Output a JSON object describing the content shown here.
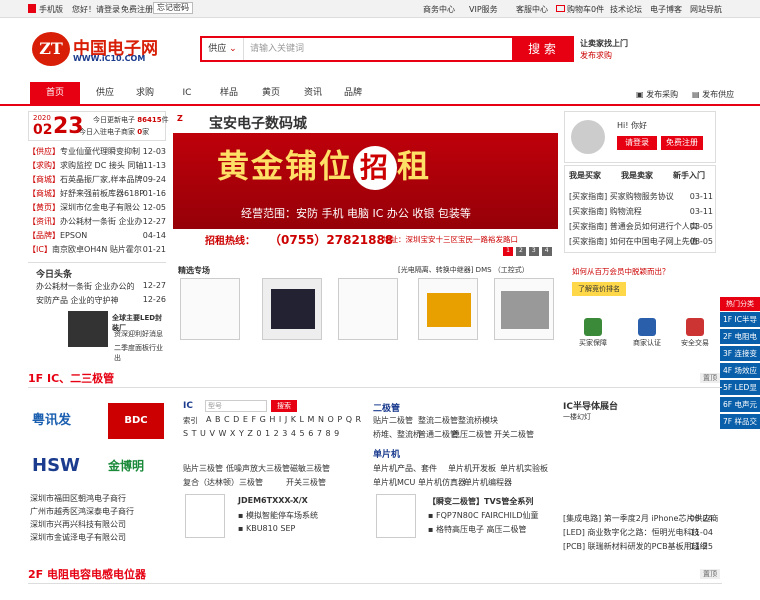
{
  "topbar": {
    "mobile": "手机版",
    "greeting": "您好！请登录",
    "register": "免费注册",
    "forgot": "忘记密码",
    "business": "商务中心",
    "vip": "VIP服务",
    "service": "客服中心",
    "cart": "购物车0件",
    "forum": "技术论坛",
    "blog": "电子博客",
    "sitenav": "网站导航"
  },
  "header": {
    "logo_mark": "ZT",
    "logo_cn": "中国电子网",
    "logo_en": "WWW.iC10.COM",
    "search_type": "供应",
    "search_placeholder": "请输入关键词",
    "search_btn": "搜 索",
    "find": "让卖家找上门",
    "publish": "发布求购"
  },
  "nav": {
    "items": [
      "首页",
      "供应",
      "求购",
      "IC",
      "样品",
      "黄页",
      "资讯",
      "品牌"
    ],
    "pub_buy": "发布采购",
    "pub_supply": "发布供应"
  },
  "date": {
    "year": "2020",
    "mmdd": "02",
    "dd": "23",
    "today_label": "今日更新电子",
    "today_count": "86415",
    "today_unit": "件",
    "today_merchants": "今日入驻电子商家",
    "merchant_count": "0",
    "merchant_unit": "家"
  },
  "news": [
    {
      "tag": "【供应】",
      "t": "专业仙童代理瞬变抑制",
      "d": "12-03"
    },
    {
      "tag": "【求购】",
      "t": "求购监控 DC 接头 同轴",
      "d": "11-13"
    },
    {
      "tag": "【商城】",
      "t": "石英晶振厂家,样本品牌",
      "d": "09-24"
    },
    {
      "tag": "【商城】",
      "t": "好舒来强前板库器618P",
      "d": "01-16"
    },
    {
      "tag": "【黄页】",
      "t": "深圳市亿金电子有限公",
      "d": "12-05"
    },
    {
      "tag": "【资讯】",
      "t": "办公耗材一条街 企业办",
      "d": "12-27"
    },
    {
      "tag": "【品牌】",
      "t": "EPSON",
      "d": "04-14"
    },
    {
      "tag": "【IC】",
      "t": "南京欧卓OH4N 贴片霍尔",
      "d": "01-21"
    }
  ],
  "headline": {
    "title": "今日头条",
    "items": [
      {
        "t": "办公耗材一条街 企业办公的",
        "d": "12-27"
      },
      {
        "t": "安防产品 企业的守护神",
        "d": "12-26"
      }
    ]
  },
  "banner": {
    "company": "宝安电子数码城",
    "big": "黄金铺位",
    "circle": "招",
    "big2": "租",
    "scope": "经营范围：安防 手机 电脑 IC 办公 收银 包装等",
    "hotline": "招租热线：",
    "phone": "（0755）27821888",
    "address": "地址：深圳宝安十三区宝民一路裕发路口",
    "dots": [
      "1",
      "2",
      "3",
      "4"
    ]
  },
  "select": {
    "title": "精选专场",
    "tags": "[光电隔离、转换中继器] DMS （工控式）"
  },
  "user": {
    "hi": "Hi! 你好",
    "login": "请登录",
    "reg": "免费注册"
  },
  "tabs": [
    "我是买家",
    "我是卖家",
    "新手入门"
  ],
  "buyer": [
    {
      "t": "[买家指南] 买家购物服务协议",
      "d": "03-11"
    },
    {
      "t": "[买家指南] 购物流程",
      "d": "03-11"
    },
    {
      "t": "[买家指南] 普通会员如何进行个人实",
      "d": "08-05"
    },
    {
      "t": "[买家指南] 如何在中国电子网上先值",
      "d": "08-05"
    }
  ],
  "promo": {
    "q": "如何从百万会员中脱颖而出？",
    "btn": "了解竞价排名"
  },
  "trust": [
    "买家保障",
    "商家认证",
    "安全交易"
  ],
  "hot": {
    "title": "热门分类",
    "items": [
      "1F IC半导体",
      "2F 电阻电容",
      "3F 连接变频",
      "4F 场效应管",
      "5F LED显示",
      "6F 电声元件",
      "7F 样品交易"
    ]
  },
  "f1": {
    "title": "1F  IC、二三极管",
    "more": "置顶",
    "logos": [
      "粤讯发",
      "BDC",
      "HSW",
      "金博明"
    ],
    "companies": [
      "深圳市福田区朝鸿电子商行",
      "广州市越秀区鸿深泰电子商行",
      "深圳市兴再兴科技有限公司",
      "深圳市金诚泽电子有限公司"
    ],
    "ic_label": "IC",
    "model_ph": "型号",
    "search": "搜索",
    "index": "索引",
    "letters1": "A B C D E F G H I J K L M N O P Q R",
    "letters2": "S T U V W X Y Z 0 1 2 3 4 5 6 7 8 9",
    "kw": [
      "贴片三极管",
      "低噪声放大三极管",
      "磁敏三极管",
      "复合（达林顿）三极管",
      "开关三极管"
    ],
    "diode": "二极管",
    "diode_kw": [
      "贴片二极管",
      "整流二极管",
      "肖特基二极管",
      "稳压二极管",
      "开关二极管",
      "桥堆、整流桥",
      "普通二极管",
      "整流桥模块"
    ],
    "mcu": "单片机",
    "mcu_kw": [
      "单片机产品、套件",
      "单片机开发板",
      "单片机实验板",
      "单片机MCU",
      "单片机仿真器",
      "单片机编程器"
    ],
    "prod1": "JDEM6TXXX-X/X",
    "prod1_a": "模拟智能停车场系统",
    "prod1_b": "KBU810 SEP",
    "prod2": "【瞬变二极管】TVS管全系列",
    "prod2_a": "FQP7N80C FAIRCHILD仙童",
    "prod2_b": "格特高压电子 高压二极管",
    "show": "IC半导体展台",
    "show_img": "一楼幻灯",
    "ind_news": [
      {
        "t": "[集成电路] 第一季度2月 iPhone芯片供应商",
        "d": "06-24"
      },
      {
        "t": "[LED] 商业数字化之路：恒明光电科技",
        "d": "11-04"
      },
      {
        "t": "[PCB] 联瑞新材料研发的PCB基板用超细",
        "d": "11-25"
      }
    ]
  },
  "f2": {
    "title": "2F  电阻电容电感电位器",
    "more": "置顶"
  }
}
